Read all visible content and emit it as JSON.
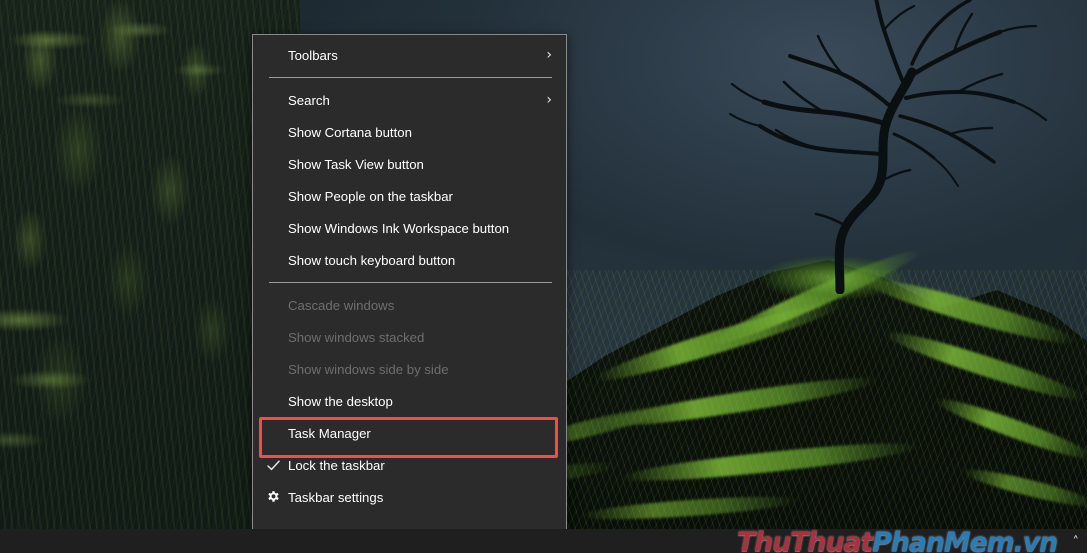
{
  "desktop": {
    "wallpaper_description": "Dark nature photo: silhouetted bare tree on a moss-covered rock, deep blue-slate cliff background",
    "colors": {
      "menu_background": "#2b2b2b",
      "menu_border": "#8a8a8a",
      "menu_text": "#ffffff",
      "menu_text_disabled": "#6e6e6e",
      "separator": "#9a9a9a",
      "highlight_box": "#f94a47",
      "taskbar": "#1f1f1f",
      "watermark_red": "#a8333f",
      "watermark_blue": "#2b7cb5"
    }
  },
  "context_menu": {
    "name": "Taskbar context menu",
    "items": [
      {
        "id": "toolbars",
        "label": "Toolbars",
        "icon": "",
        "arrow": "›",
        "disabled": false,
        "highlighted": false
      },
      {
        "id": "sep-1",
        "label": "",
        "type": "separator"
      },
      {
        "id": "search",
        "label": "Search",
        "icon": "",
        "arrow": "›",
        "disabled": false,
        "highlighted": false
      },
      {
        "id": "cortana",
        "label": "Show Cortana button",
        "icon": "",
        "arrow": "",
        "disabled": false,
        "highlighted": false
      },
      {
        "id": "taskview",
        "label": "Show Task View button",
        "icon": "",
        "arrow": "",
        "disabled": false,
        "highlighted": false
      },
      {
        "id": "people",
        "label": "Show People on the taskbar",
        "icon": "",
        "arrow": "",
        "disabled": false,
        "highlighted": false
      },
      {
        "id": "ink",
        "label": "Show Windows Ink Workspace button",
        "icon": "",
        "arrow": "",
        "disabled": false,
        "highlighted": false
      },
      {
        "id": "touchkeyboard",
        "label": "Show touch keyboard button",
        "icon": "",
        "arrow": "",
        "disabled": false,
        "highlighted": false
      },
      {
        "id": "sep-2",
        "label": "",
        "type": "separator"
      },
      {
        "id": "cascade",
        "label": "Cascade windows",
        "icon": "",
        "arrow": "",
        "disabled": true,
        "highlighted": false
      },
      {
        "id": "stacked",
        "label": "Show windows stacked",
        "icon": "",
        "arrow": "",
        "disabled": true,
        "highlighted": false
      },
      {
        "id": "sidebyside",
        "label": "Show windows side by side",
        "icon": "",
        "arrow": "",
        "disabled": true,
        "highlighted": false
      },
      {
        "id": "showdesktop",
        "label": "Show the desktop",
        "icon": "",
        "arrow": "",
        "disabled": false,
        "highlighted": false
      },
      {
        "id": "taskmanager",
        "label": "Task Manager",
        "icon": "",
        "arrow": "",
        "disabled": false,
        "highlighted": true
      },
      {
        "id": "lock",
        "label": "Lock the taskbar",
        "icon": "check-icon",
        "arrow": "",
        "disabled": false,
        "highlighted": false
      },
      {
        "id": "settings",
        "label": "Taskbar settings",
        "icon": "gear-icon",
        "arrow": "",
        "disabled": false,
        "highlighted": false
      }
    ]
  },
  "taskbar": {
    "watermark_part1": "ThuThuat",
    "watermark_part2": "PhanMem.vn",
    "tray_chevron": "˄"
  }
}
